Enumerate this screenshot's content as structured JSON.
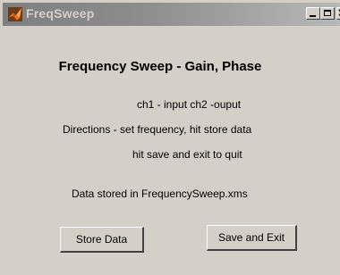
{
  "window": {
    "title": "FreqSweep",
    "app_icon": "matlab-icon",
    "controls": {
      "minimize_icon": "minimize-icon",
      "maximize_icon": "maximize-icon",
      "close_icon": "close-icon",
      "close_glyph": "×"
    }
  },
  "main": {
    "heading": "Frequency Sweep - Gain, Phase",
    "channels_text": "ch1 - input ch2 -ouput",
    "directions_line1": "Directions - set frequency, hit store data",
    "directions_line2": "hit save and exit to quit",
    "status_text": "Data stored in FrequencySweep.xms"
  },
  "buttons": {
    "store_label": "Store Data",
    "save_exit_label": "Save and Exit"
  },
  "colors": {
    "face": "#d4d0c8",
    "titlebar_inactive": "#8c8c8c",
    "icon_orange": "#e8701c"
  }
}
